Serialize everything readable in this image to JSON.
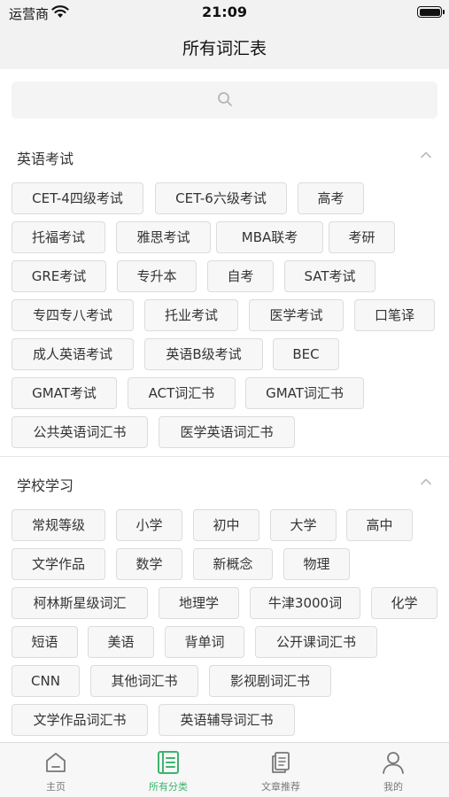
{
  "status": {
    "carrier": "运营商",
    "time": "21:09"
  },
  "nav": {
    "title": "所有词汇表"
  },
  "search": {
    "placeholder": ""
  },
  "colors": {
    "accent": "#3cb46e",
    "chip_bg": "#f7f7f7",
    "chip_border": "#dcdcdc"
  },
  "sections": [
    {
      "title": "英语考试",
      "items": [
        "CET-4四级考试",
        "CET-6六级考试",
        "高考",
        "托福考试",
        "雅思考试",
        "MBA联考",
        "考研",
        "GRE考试",
        "专升本",
        "自考",
        "SAT考试",
        "专四专八考试",
        "托业考试",
        "医学考试",
        "口笔译",
        "成人英语考试",
        "英语B级考试",
        "BEC",
        "GMAT考试",
        "ACT词汇书",
        "GMAT词汇书",
        "公共英语词汇书",
        "医学英语词汇书"
      ]
    },
    {
      "title": "学校学习",
      "items": [
        "常规等级",
        "小学",
        "初中",
        "大学",
        "高中",
        "文学作品",
        "数学",
        "新概念",
        "物理",
        "柯林斯星级词汇",
        "地理学",
        "牛津3000词",
        "化学",
        "短语",
        "美语",
        "背单词",
        "公开课词汇书",
        "CNN",
        "其他词汇书",
        "影视剧词汇书",
        "文学作品词汇书",
        "英语辅导词汇书"
      ]
    }
  ],
  "tabs": [
    {
      "label": "主页",
      "icon": "home-icon",
      "active": false
    },
    {
      "label": "所有分类",
      "icon": "book-list-icon",
      "active": true
    },
    {
      "label": "文章推荐",
      "icon": "article-icon",
      "active": false
    },
    {
      "label": "我的",
      "icon": "user-icon",
      "active": false
    }
  ]
}
